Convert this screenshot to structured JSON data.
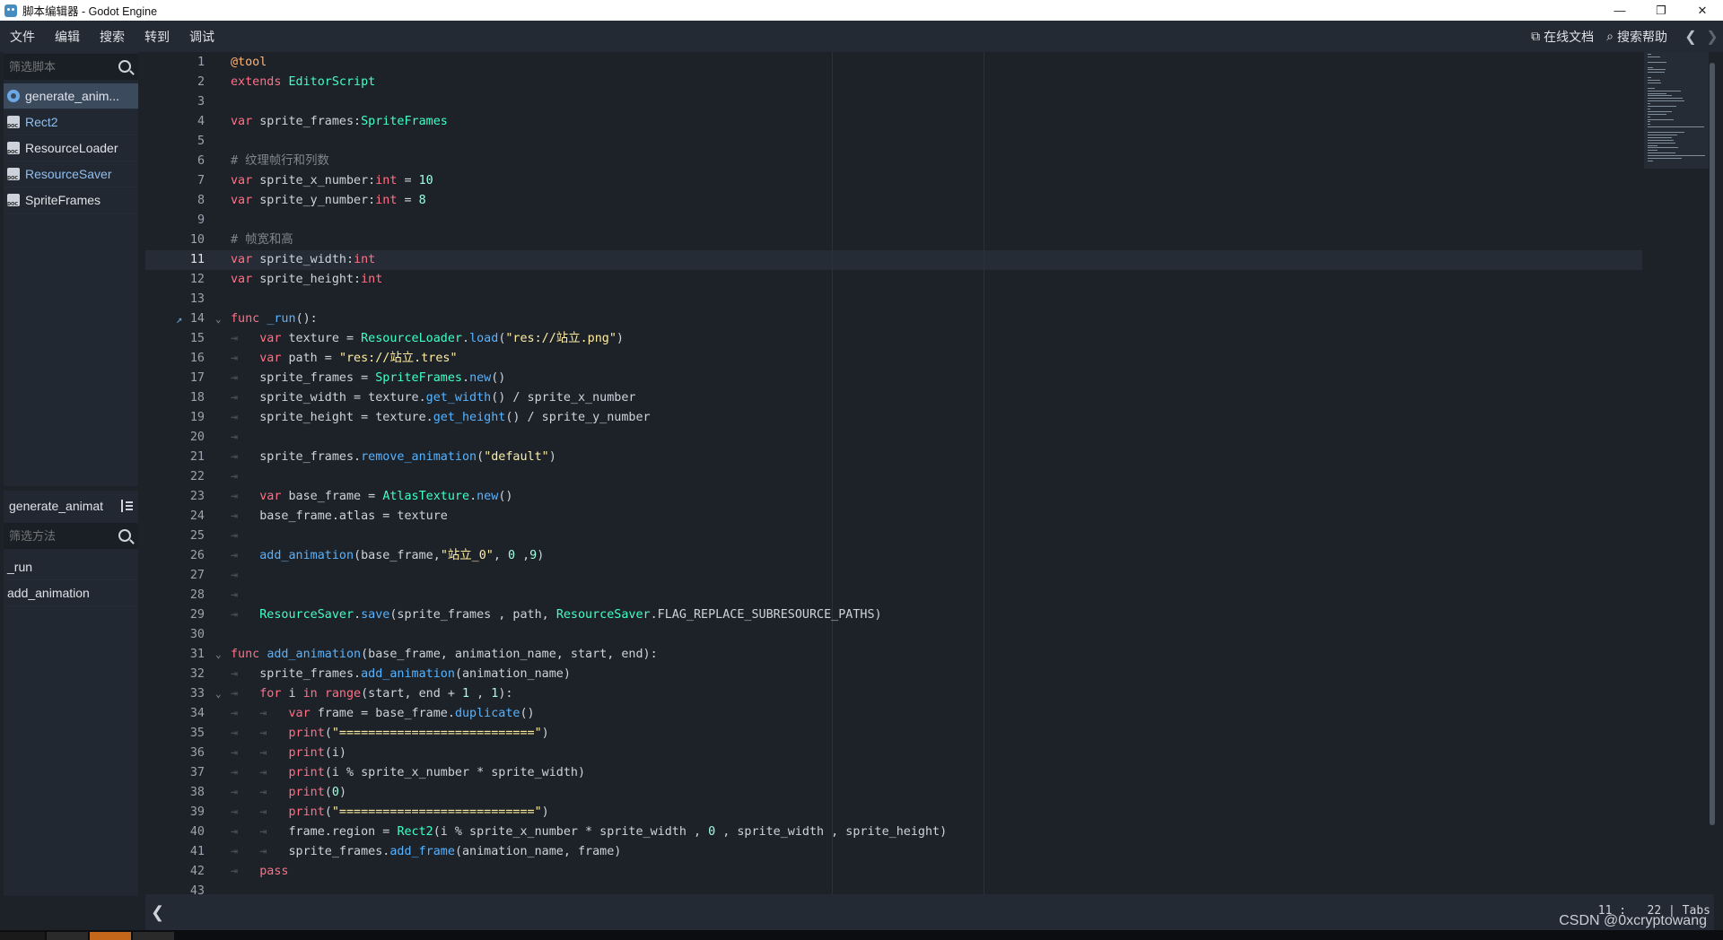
{
  "window": {
    "title": "脚本编辑器 - Godot Engine",
    "controls": [
      "—",
      "❐",
      "✕"
    ]
  },
  "menu": {
    "items": [
      "文件",
      "编辑",
      "搜索",
      "转到",
      "调试"
    ],
    "online_docs": "在线文档",
    "search_help": "搜索帮助",
    "nav_back": "❮",
    "nav_forward": "❯"
  },
  "scripts_panel": {
    "filter_placeholder": "筛选脚本",
    "items": [
      {
        "label": "generate_anim...",
        "icon": "gear-icon",
        "active": true
      },
      {
        "label": "Rect2",
        "icon": "doc-icon"
      },
      {
        "label": "ResourceLoader",
        "icon": "doc-icon"
      },
      {
        "label": "ResourceSaver",
        "icon": "doc-icon"
      },
      {
        "label": "SpriteFrames",
        "icon": "doc-icon"
      }
    ]
  },
  "methods_panel": {
    "current_script": "generate_animat",
    "filter_placeholder": "筛选方法",
    "items": [
      "_run",
      "add_animation"
    ]
  },
  "editor": {
    "current_line": 11,
    "lines": [
      {
        "n": "1",
        "code": "@tool"
      },
      {
        "n": "2",
        "code": "extends EditorScript"
      },
      {
        "n": "3",
        "code": ""
      },
      {
        "n": "4",
        "code": "var sprite_frames:SpriteFrames"
      },
      {
        "n": "5",
        "code": ""
      },
      {
        "n": "6",
        "code": "# 纹理帧行和列数"
      },
      {
        "n": "7",
        "code": "var sprite_x_number:int = 10"
      },
      {
        "n": "8",
        "code": "var sprite_y_number:int = 8"
      },
      {
        "n": "9",
        "code": ""
      },
      {
        "n": "10",
        "code": "# 帧宽和高"
      },
      {
        "n": "11",
        "code": "var sprite_width:int"
      },
      {
        "n": "12",
        "code": "var sprite_height:int"
      },
      {
        "n": "13",
        "code": ""
      },
      {
        "n": "14",
        "code": "func _run():"
      },
      {
        "n": "15",
        "code": "\tvar texture = ResourceLoader.load(\"res://站立.png\")"
      },
      {
        "n": "16",
        "code": "\tvar path = \"res://站立.tres\""
      },
      {
        "n": "17",
        "code": "\tsprite_frames = SpriteFrames.new()"
      },
      {
        "n": "18",
        "code": "\tsprite_width = texture.get_width() / sprite_x_number"
      },
      {
        "n": "19",
        "code": "\tsprite_height = texture.get_height() / sprite_y_number"
      },
      {
        "n": "20",
        "code": "\t"
      },
      {
        "n": "21",
        "code": "\tsprite_frames.remove_animation(\"default\")"
      },
      {
        "n": "22",
        "code": "\t"
      },
      {
        "n": "23",
        "code": "\tvar base_frame = AtlasTexture.new()"
      },
      {
        "n": "24",
        "code": "\tbase_frame.atlas = texture"
      },
      {
        "n": "25",
        "code": "\t"
      },
      {
        "n": "26",
        "code": "\tadd_animation(base_frame,\"站立_0\", 0 ,9)"
      },
      {
        "n": "27",
        "code": "\t"
      },
      {
        "n": "28",
        "code": "\t"
      },
      {
        "n": "29",
        "code": "\tResourceSaver.save(sprite_frames , path, ResourceSaver.FLAG_REPLACE_SUBRESOURCE_PATHS)"
      },
      {
        "n": "30",
        "code": ""
      },
      {
        "n": "31",
        "code": "func add_animation(base_frame, animation_name, start, end):"
      },
      {
        "n": "32",
        "code": "\tsprite_frames.add_animation(animation_name)"
      },
      {
        "n": "33",
        "code": "\tfor i in range(start, end + 1 , 1):"
      },
      {
        "n": "34",
        "code": "\t\tvar frame = base_frame.duplicate()"
      },
      {
        "n": "35",
        "code": "\t\tprint(\"===========================\")"
      },
      {
        "n": "36",
        "code": "\t\tprint(i)"
      },
      {
        "n": "37",
        "code": "\t\tprint(i % sprite_x_number * sprite_width)"
      },
      {
        "n": "38",
        "code": "\t\tprint(0)"
      },
      {
        "n": "39",
        "code": "\t\tprint(\"===========================\")"
      },
      {
        "n": "40",
        "code": "\t\tframe.region = Rect2(i % sprite_x_number * sprite_width , 0 , sprite_width , sprite_height)"
      },
      {
        "n": "41",
        "code": "\t\tsprite_frames.add_frame(animation_name, frame)"
      },
      {
        "n": "42",
        "code": "\tpass"
      },
      {
        "n": "43",
        "code": ""
      }
    ]
  },
  "status": {
    "back": "❮",
    "cursor": "11 :   22 | Tabs"
  },
  "watermark": "CSDN @0xcryptowang",
  "colors": {
    "keyword": "#ff7085",
    "type": "#42ffc2",
    "function": "#57b3ff",
    "string": "#ffeda1",
    "number": "#a1ffe0",
    "comment": "#7f858e",
    "annotation": "#ffb373"
  }
}
